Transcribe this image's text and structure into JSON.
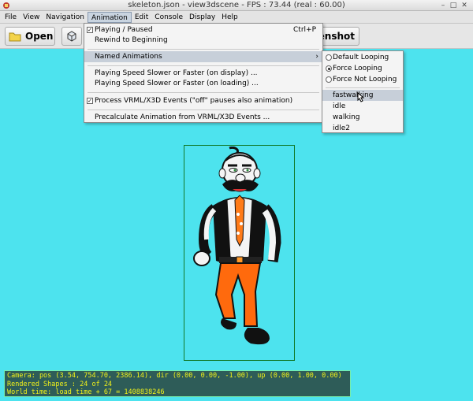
{
  "window": {
    "title": "skeleton.json - view3dscene - FPS : 73.44 (real : 60.00)"
  },
  "menubar": {
    "items": [
      "File",
      "View",
      "Navigation",
      "Animation",
      "Edit",
      "Console",
      "Display",
      "Help"
    ]
  },
  "toolbar": {
    "open_label": "Open",
    "screenshot_label": "eenshot"
  },
  "animation_menu": {
    "playing_paused": "Playing / Paused",
    "playing_paused_shortcut": "Ctrl+P",
    "rewind": "Rewind to Beginning",
    "named_animations": "Named Animations",
    "speed_display": "Playing Speed Slower or Faster (on display) ...",
    "speed_loading": "Playing Speed Slower or Faster (on loading) ...",
    "process_events": "Process VRML/X3D Events (\"off\" pauses also animation)",
    "precalculate": "Precalculate Animation from VRML/X3D Events ..."
  },
  "named_submenu": {
    "loop_options": [
      "Default Looping",
      "Force Looping",
      "Force Not Looping"
    ],
    "selected_loop": "Force Looping",
    "animations": [
      "fastwalking",
      "idle",
      "walking",
      "idle2"
    ],
    "highlighted": "fastwalking"
  },
  "status": {
    "camera": "Camera: pos (3.54, 754.70, 2386.14), dir (0.00, 0.00, -1.00), up (0.00, 1.00, 0.00)",
    "shapes": "Rendered Shapes : 24 of 24",
    "world_time": "World time: load time + 67 = 1408838246"
  },
  "colors": {
    "viewport_bg": "#4de3ee",
    "status_text": "#f1f21a",
    "status_bg": "#2e5c58",
    "frame": "#117a2a"
  }
}
